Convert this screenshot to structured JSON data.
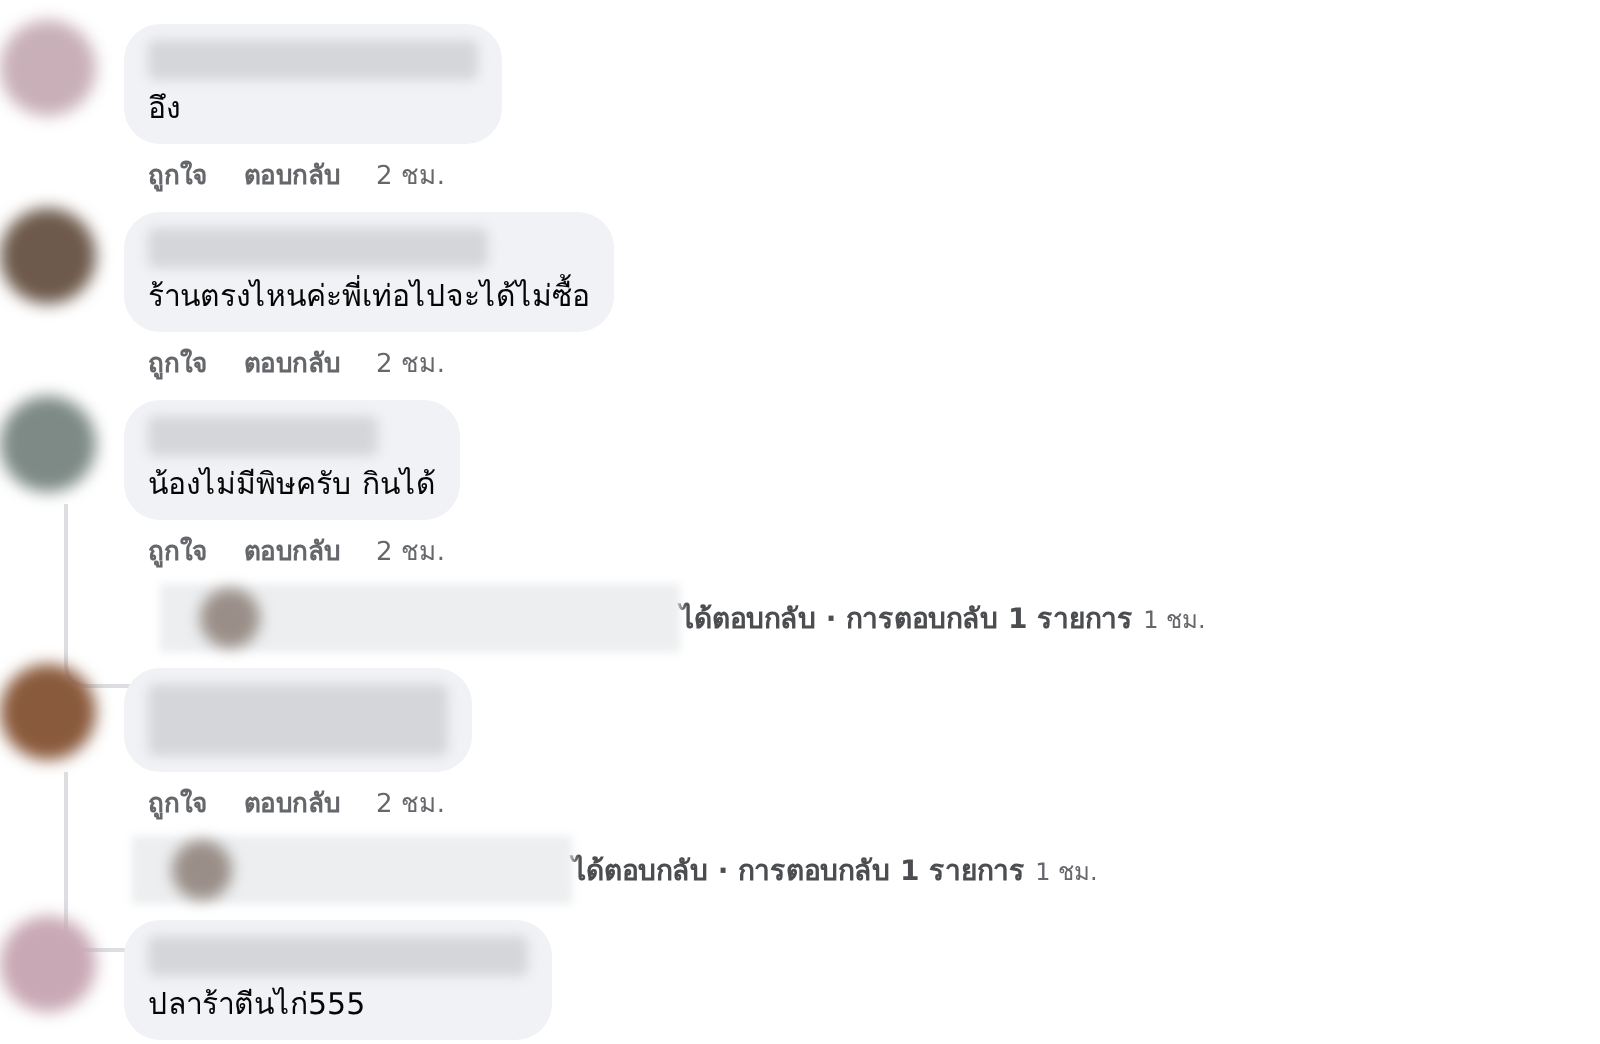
{
  "comments": [
    {
      "text": "อึง",
      "like": "ถูกใจ",
      "reply": "ตอบกลับ",
      "time": "2 ชม."
    },
    {
      "text": "ร้านตรงไหนค่ะพี่เท่อไปจะได้ไม่ซื้อ",
      "like": "ถูกใจ",
      "reply": "ตอบกลับ",
      "time": "2 ชม."
    },
    {
      "text": "น้องไม่มีพิษครับ กินได้",
      "like": "ถูกใจ",
      "reply": "ตอบกลับ",
      "time": "2 ชม.",
      "replies": {
        "text": "ได้ตอบกลับ · การตอบกลับ 1 รายการ",
        "time": "1 ชม."
      }
    },
    {
      "like": "ถูกใจ",
      "reply": "ตอบกลับ",
      "time": "2 ชม.",
      "replies": {
        "text": "ได้ตอบกลับ · การตอบกลับ 1 รายการ",
        "time": "1 ชม."
      }
    },
    {
      "text": "ปลาร้าตีนไก่555"
    }
  ]
}
